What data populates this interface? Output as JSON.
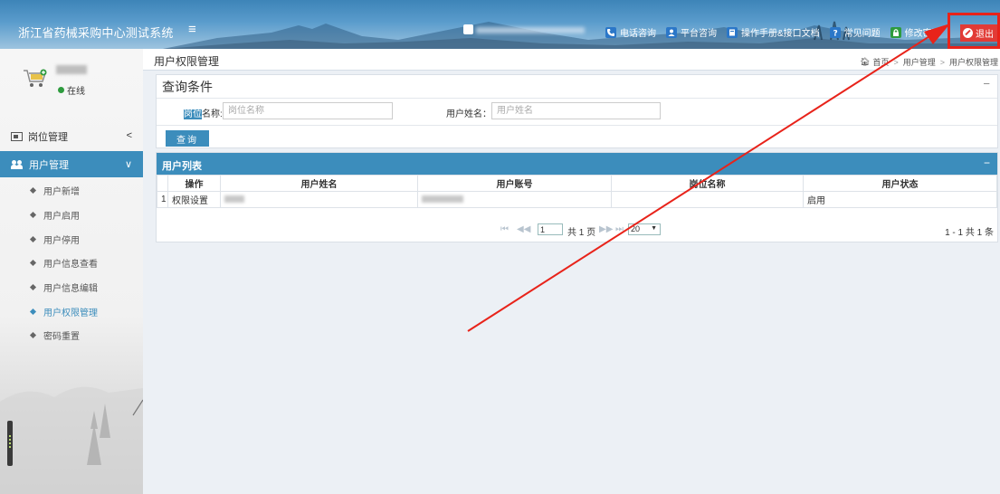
{
  "header": {
    "title": "浙江省药械采购中心测试系统",
    "menu_toggle": "≡",
    "nav": [
      {
        "label": "电话咨询",
        "icon": "phone-icon",
        "color": "#2b77c8"
      },
      {
        "label": "平台咨询",
        "icon": "user-chat-icon",
        "color": "#2b77c8"
      },
      {
        "label": "操作手册&接口文档",
        "icon": "book-icon",
        "color": "#2b77c8"
      },
      {
        "label": "常见问题",
        "icon": "question-icon",
        "color": "#2b77c8"
      },
      {
        "label": "修改密码",
        "icon": "lock-icon",
        "color": "#2e9b3e"
      }
    ],
    "logout_label": "退出",
    "logout_color": "#e23b36"
  },
  "sidebar": {
    "status": "在线",
    "groups": [
      {
        "label": "岗位管理",
        "arrow": "<",
        "icon": "id-card-icon"
      },
      {
        "label": "用户管理",
        "arrow": "∨",
        "icon": "users-icon"
      }
    ],
    "items": [
      {
        "label": "用户新增"
      },
      {
        "label": "用户启用"
      },
      {
        "label": "用户停用"
      },
      {
        "label": "用户信息查看"
      },
      {
        "label": "用户信息编辑"
      },
      {
        "label": "用户权限管理"
      },
      {
        "label": "密码重置"
      }
    ]
  },
  "page": {
    "title": "用户权限管理",
    "breadcrumb": {
      "home": "首页",
      "parent": "用户管理",
      "current": "用户权限管理"
    }
  },
  "query": {
    "title": "查询条件",
    "collapse": "−",
    "position_label_hl": "岗位",
    "position_label_rest": "名称:",
    "position_placeholder": "岗位名称",
    "username_label": "用户姓名：",
    "username_placeholder": "用户姓名",
    "button": "查询"
  },
  "list": {
    "title": "用户列表",
    "collapse": "−",
    "columns": [
      "操作",
      "用户姓名",
      "用户账号",
      "岗位名称",
      "用户状态"
    ],
    "rows": [
      {
        "index": "1",
        "action": "权限设置",
        "status": "启用"
      }
    ],
    "pager": {
      "first": "⏮",
      "prev": "◀◀",
      "page": "1",
      "page_text": "共 1 页",
      "next": "▶▶",
      "last": "⏭",
      "page_size": "20",
      "info": "1 - 1  共 1 条"
    }
  },
  "accent_color": "#3c8dbc",
  "annotation_color": "#e8231a"
}
